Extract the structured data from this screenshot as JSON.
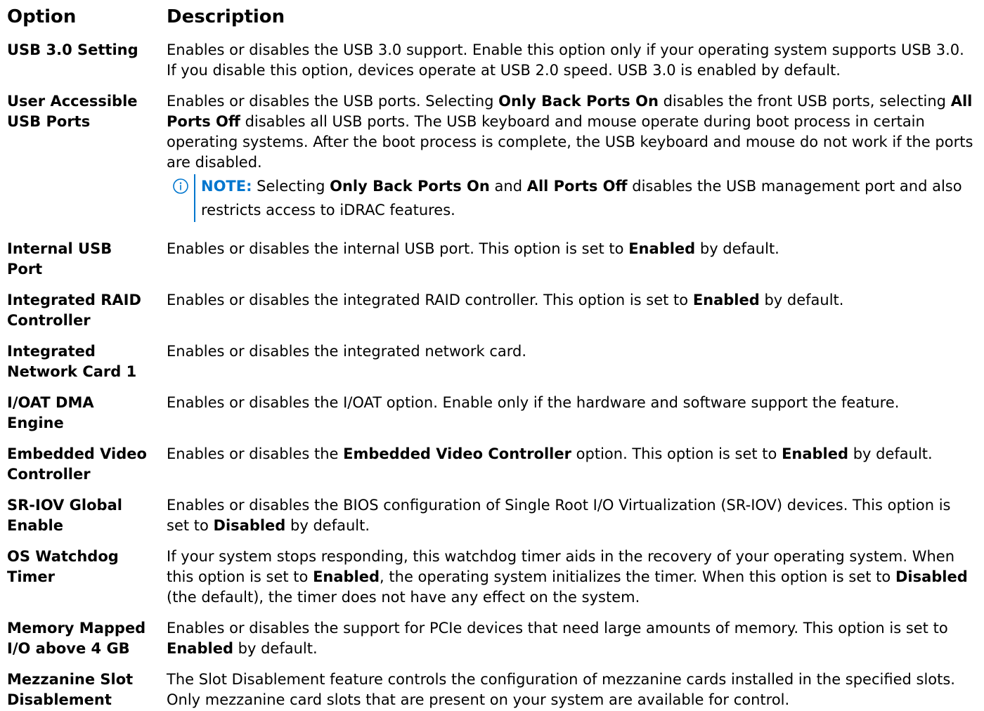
{
  "colors": {
    "text": "#000000",
    "note_accent": "#0076CE"
  },
  "table": {
    "headers": {
      "option": "Option",
      "description": "Description"
    },
    "rows": [
      {
        "option": "USB 3.0 Setting",
        "description": [
          {
            "text": "Enables or disables the USB 3.0 support. Enable this option only if your operating system supports USB 3.0. If you disable this option, devices operate at USB 2.0 speed. USB 3.0 is enabled by default.",
            "bold": false
          }
        ]
      },
      {
        "option": "User Accessible USB Ports",
        "description": [
          {
            "text": "Enables or disables the USB ports. Selecting ",
            "bold": false
          },
          {
            "text": "Only Back Ports On",
            "bold": true
          },
          {
            "text": " disables the front USB ports, selecting ",
            "bold": false
          },
          {
            "text": "All Ports Off",
            "bold": true
          },
          {
            "text": " disables all USB ports. The USB keyboard and mouse operate during boot process in certain operating systems. After the boot process is complete, the USB keyboard and mouse do not work if the ports are disabled.",
            "bold": false
          }
        ],
        "note": {
          "icon": "info-icon",
          "label": "NOTE:",
          "segments": [
            {
              "text": " Selecting ",
              "bold": false
            },
            {
              "text": "Only Back Ports On",
              "bold": true
            },
            {
              "text": " and ",
              "bold": false
            },
            {
              "text": "All Ports Off",
              "bold": true
            },
            {
              "text": " disables the USB management port and also restricts access to iDRAC features.",
              "bold": false
            }
          ]
        }
      },
      {
        "option": "Internal USB Port",
        "description": [
          {
            "text": "Enables or disables the internal USB port. This option is set to ",
            "bold": false
          },
          {
            "text": "Enabled",
            "bold": true
          },
          {
            "text": " by default.",
            "bold": false
          }
        ]
      },
      {
        "option": "Integrated RAID Controller",
        "description": [
          {
            "text": "Enables or disables the integrated RAID controller. This option is set to ",
            "bold": false
          },
          {
            "text": "Enabled",
            "bold": true
          },
          {
            "text": " by default.",
            "bold": false
          }
        ]
      },
      {
        "option": "Integrated Network Card 1",
        "description": [
          {
            "text": "Enables or disables the integrated network card.",
            "bold": false
          }
        ]
      },
      {
        "option": "I/OAT DMA Engine",
        "description": [
          {
            "text": "Enables or disables the I/OAT option. Enable only if the hardware and software support the feature.",
            "bold": false
          }
        ]
      },
      {
        "option": "Embedded Video Controller",
        "description": [
          {
            "text": "Enables or disables the ",
            "bold": false
          },
          {
            "text": "Embedded Video Controller",
            "bold": true
          },
          {
            "text": " option. This option is set to ",
            "bold": false
          },
          {
            "text": "Enabled",
            "bold": true
          },
          {
            "text": " by default.",
            "bold": false
          }
        ]
      },
      {
        "option": "SR-IOV Global Enable",
        "description": [
          {
            "text": "Enables or disables the BIOS configuration of Single Root I/O Virtualization (SR-IOV) devices. This option is set to ",
            "bold": false
          },
          {
            "text": "Disabled",
            "bold": true
          },
          {
            "text": " by default.",
            "bold": false
          }
        ]
      },
      {
        "option": "OS Watchdog Timer",
        "description": [
          {
            "text": "If your system stops responding, this watchdog timer aids in the recovery of your operating system. When this option is set to ",
            "bold": false
          },
          {
            "text": "Enabled",
            "bold": true
          },
          {
            "text": ", the operating system initializes the timer. When this option is set to ",
            "bold": false
          },
          {
            "text": "Disabled",
            "bold": true
          },
          {
            "text": " (the default), the timer does not have any effect on the system.",
            "bold": false
          }
        ]
      },
      {
        "option": "Memory Mapped I/O above 4 GB",
        "description": [
          {
            "text": "Enables or disables the support for PCIe devices that need large amounts of memory. This option is set to ",
            "bold": false
          },
          {
            "text": "Enabled",
            "bold": true
          },
          {
            "text": " by default.",
            "bold": false
          }
        ]
      },
      {
        "option": "Mezzanine Slot Disablement",
        "description": [
          {
            "text": "The Slot Disablement feature controls the configuration of mezzanine cards installed in the specified slots. Only mezzanine card slots that are present on your system are available for control.",
            "bold": false
          }
        ]
      }
    ]
  }
}
